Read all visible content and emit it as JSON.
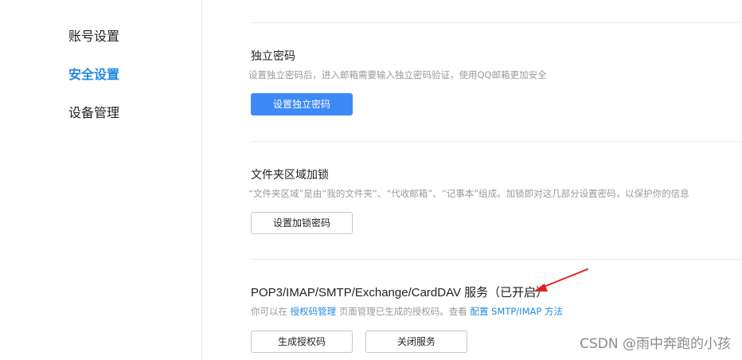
{
  "sidebar": {
    "items": [
      {
        "label": "账号设置"
      },
      {
        "label": "安全设置"
      },
      {
        "label": "设备管理"
      }
    ]
  },
  "sections": {
    "independent_password": {
      "title": "独立密码",
      "desc": "设置独立密码后，进入邮箱需要输入独立密码验证，使用QQ邮箱更加安全",
      "button": "设置独立密码"
    },
    "folder_lock": {
      "title": "文件夹区域加锁",
      "desc": "“文件夹区域”是由“我的文件夹”、“代收邮箱”、“记事本”组成。加锁即对这几部分设置密码，以保护你的信息",
      "button": "设置加锁密码"
    },
    "pop3": {
      "title": "POP3/IMAP/SMTP/Exchange/CardDAV 服务（已开启）",
      "desc_prefix": "你可以在",
      "desc_link1": "授权码管理",
      "desc_middle": "页面管理已生成的授权码。查看",
      "desc_link2": "配置 SMTP/IMAP 方法",
      "button_generate": "生成授权码",
      "button_close": "关闭服务"
    }
  },
  "colors": {
    "accent": "#1e88e5",
    "primary_button": "#3d8af7",
    "annotation_arrow": "#e02020"
  },
  "watermark": "CSDN @雨中奔跑的小孩"
}
